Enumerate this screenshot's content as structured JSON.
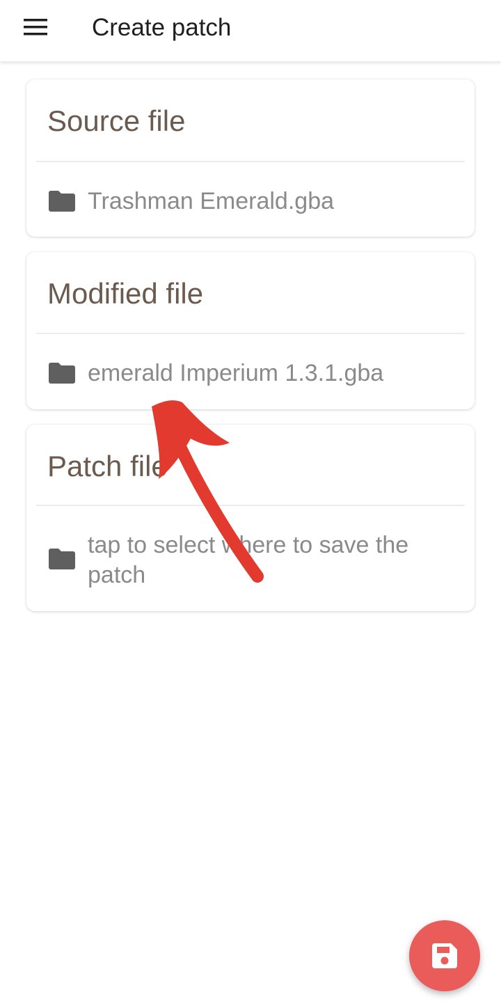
{
  "appbar": {
    "title": "Create patch",
    "menu_icon": "hamburger-menu-icon"
  },
  "cards": [
    {
      "title": "Source file",
      "icon": "folder-icon",
      "value": "Trashman Emerald.gba"
    },
    {
      "title": "Modified file",
      "icon": "folder-icon",
      "value": "emerald Imperium 1.3.1.gba"
    },
    {
      "title": "Patch file",
      "icon": "folder-icon",
      "value": "tap to select where to save the patch"
    }
  ],
  "fab": {
    "icon": "save-icon",
    "color": "#e95c59"
  },
  "colors": {
    "card_title": "#6b5a4e",
    "value_text": "#8a8a8a",
    "annotation_arrow": "#e23a2e"
  }
}
